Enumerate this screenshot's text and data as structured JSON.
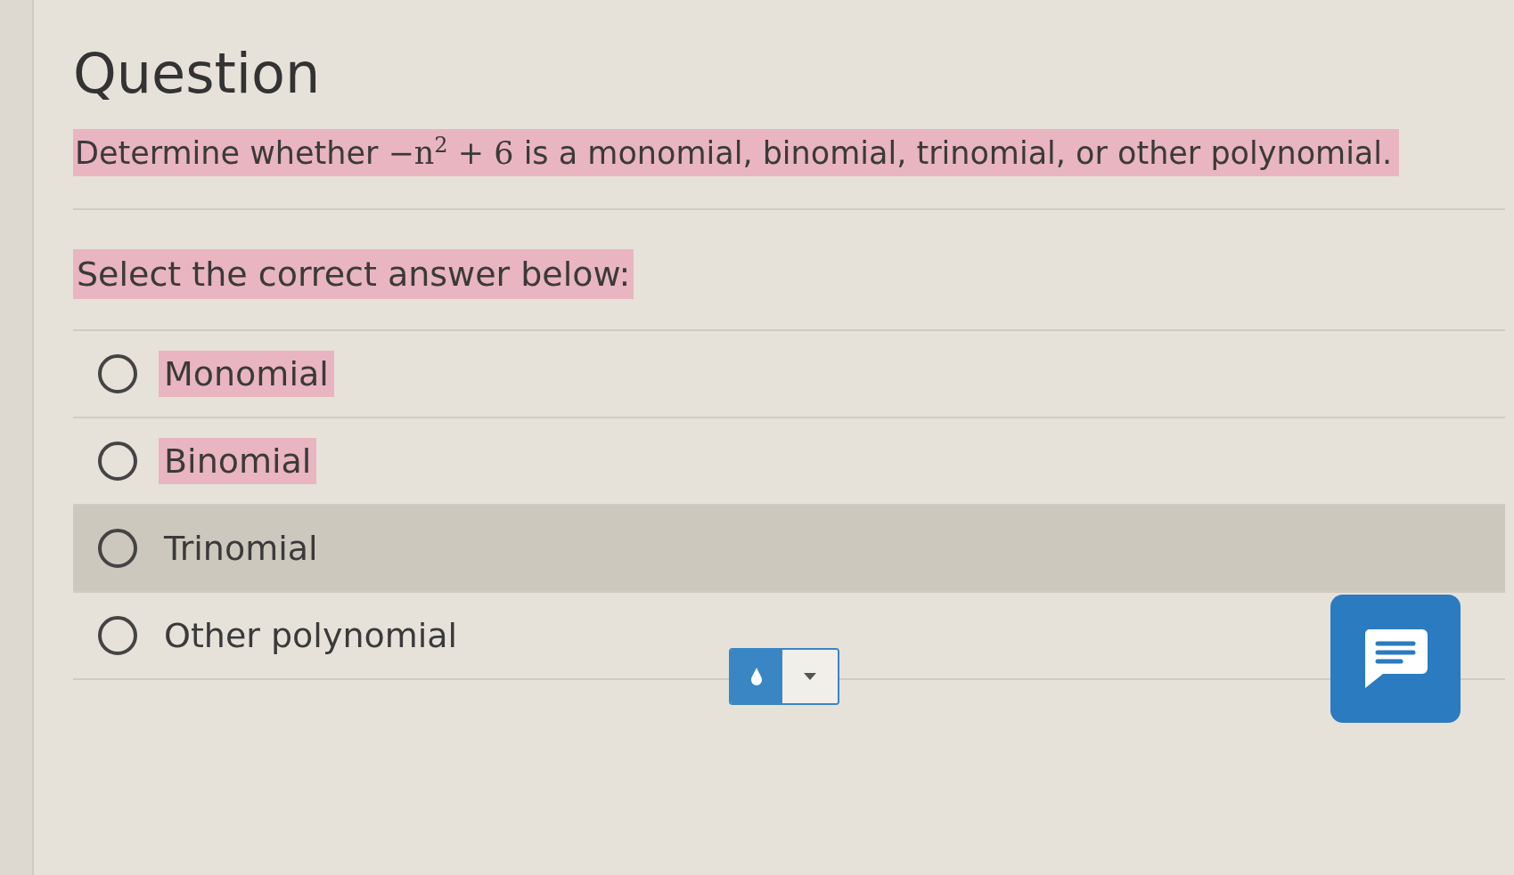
{
  "title": "Question",
  "question": {
    "highlighted": true,
    "parts": [
      {
        "kind": "text",
        "text": "Determine whether "
      },
      {
        "kind": "math",
        "text": "−n$^{2}$ + 6"
      },
      {
        "kind": "text",
        "text": " is a monomial, binomial, trinomial, or other polynomial."
      }
    ]
  },
  "instruction": {
    "text": "Select the correct answer below:",
    "highlighted": true
  },
  "options": [
    {
      "label": "Monomial",
      "selected": false,
      "highlighted": true,
      "hovered": false
    },
    {
      "label": "Binomial",
      "selected": false,
      "highlighted": true,
      "hovered": false
    },
    {
      "label": "Trinomial",
      "selected": false,
      "highlighted": false,
      "hovered": true
    },
    {
      "label": "Other polynomial",
      "selected": false,
      "highlighted": false,
      "hovered": false
    }
  ]
}
